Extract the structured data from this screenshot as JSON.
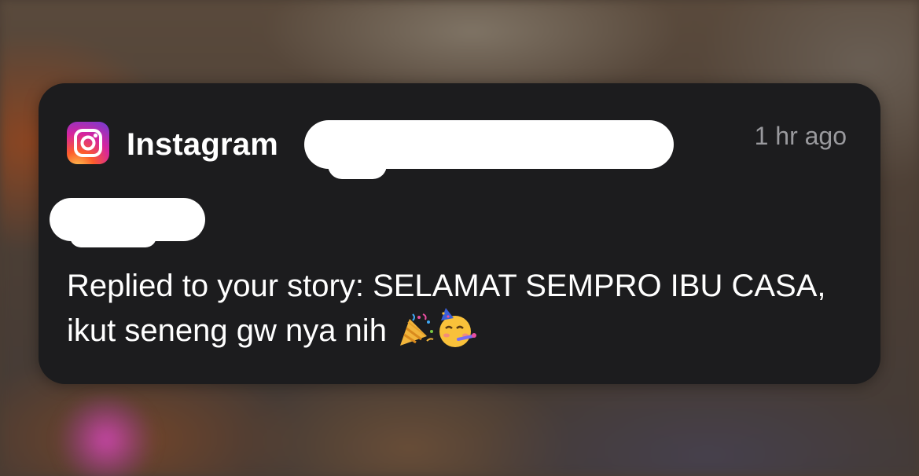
{
  "notification": {
    "app_name": "Instagram",
    "app_icon": "instagram-icon",
    "time": "1 hr ago",
    "message": "Replied to your story: SELAMAT SEMPRO IBU CASA, ikut seneng gw nya nih",
    "emojis": [
      "party-popper-icon",
      "partying-face-icon"
    ]
  },
  "colors": {
    "card_background": "#1c1c1e",
    "primary_text": "#ffffff",
    "secondary_text": "#9a9a9e",
    "redaction": "#ffffff"
  }
}
